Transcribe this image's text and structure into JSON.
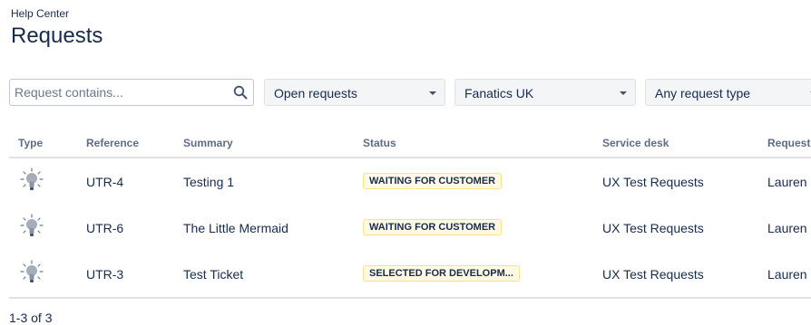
{
  "breadcrumb": "Help Center",
  "title": "Requests",
  "filters": {
    "search_placeholder": "Request contains...",
    "status_filter": "Open requests",
    "organization_filter": "Fanatics UK",
    "type_filter": "Any request type"
  },
  "columns": [
    "Type",
    "Reference",
    "Summary",
    "Status",
    "Service desk",
    "Requester"
  ],
  "rows": [
    {
      "type_icon": "lightbulb-icon",
      "reference": "UTR-4",
      "summary": "Testing 1",
      "status": "WAITING FOR CUSTOMER",
      "service_desk": "UX Test Requests",
      "requester": "Lauren B"
    },
    {
      "type_icon": "lightbulb-icon",
      "reference": "UTR-6",
      "summary": "The Little Mermaid",
      "status": "WAITING FOR CUSTOMER",
      "service_desk": "UX Test Requests",
      "requester": "Lauren B"
    },
    {
      "type_icon": "lightbulb-icon",
      "reference": "UTR-3",
      "summary": "Test Ticket",
      "status": "SELECTED FOR DEVELOPM...",
      "service_desk": "UX Test Requests",
      "requester": "Lauren B"
    }
  ],
  "pagination": "1-3 of 3",
  "colors": {
    "status_background": "#fffae6",
    "status_border": "#ffe380",
    "text": "#172b4d"
  }
}
